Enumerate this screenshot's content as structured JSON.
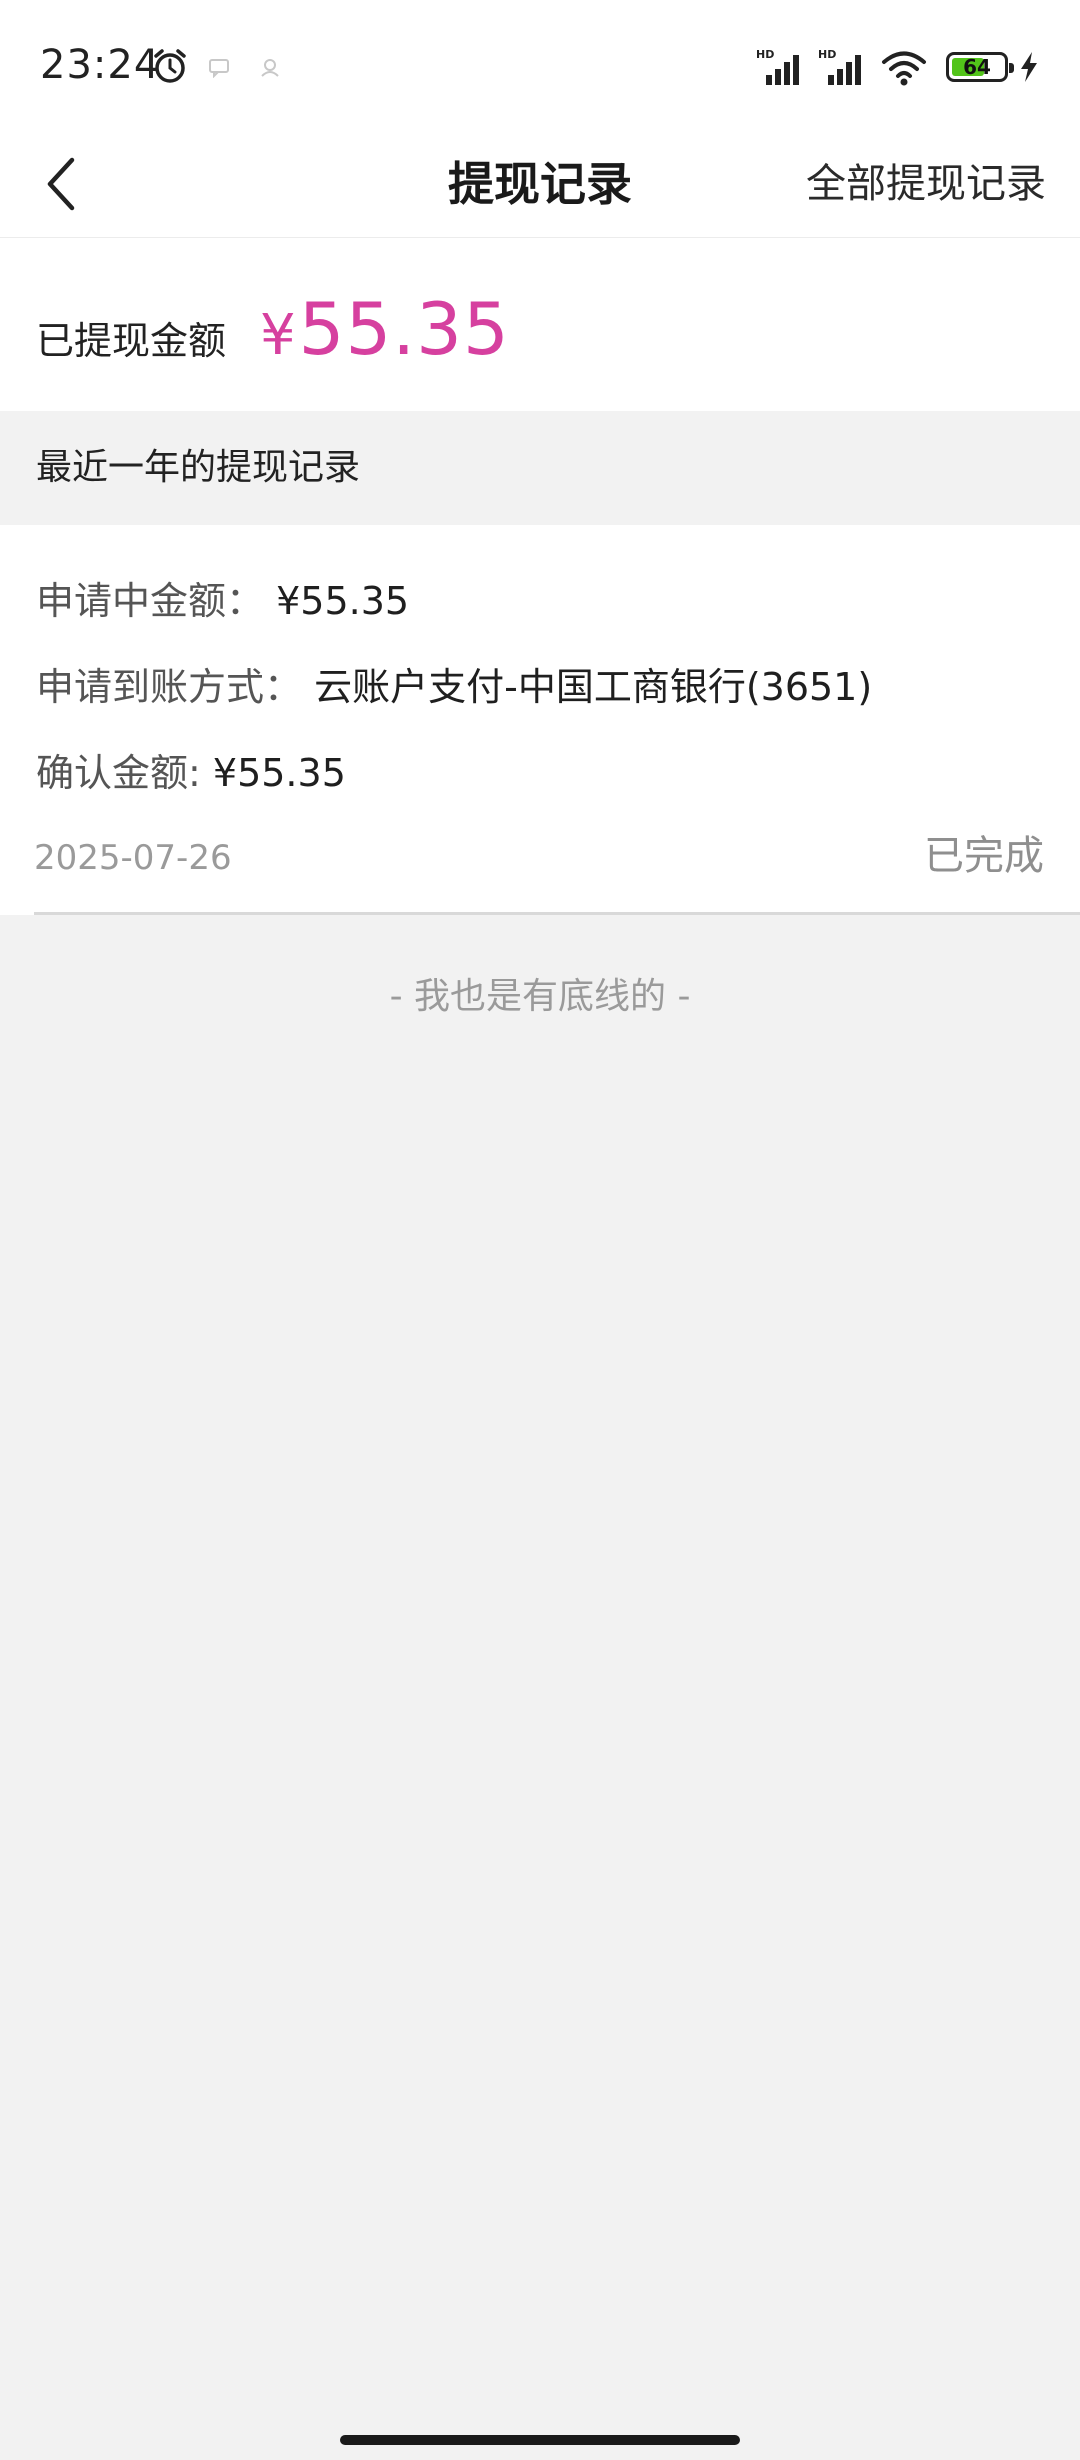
{
  "status_bar": {
    "time": "23:24",
    "battery": "64",
    "battery_level_percent": 64,
    "signal_labels": [
      "HD",
      "HD"
    ],
    "icons": [
      "alarm-icon",
      "message-icon",
      "app-notification-icon",
      "signal-icon",
      "wifi-icon",
      "battery-icon",
      "charging-icon"
    ]
  },
  "nav": {
    "title": "提现记录",
    "right_label": "全部提现记录",
    "back_icon": "chevron-left-icon"
  },
  "summary": {
    "label": "已提现金额",
    "currency": "¥",
    "amount": "55.35"
  },
  "section": {
    "title": "最近一年的提现记录"
  },
  "records": [
    {
      "applying_label": "申请中金额：",
      "applying_value": "¥55.35",
      "method_label": "申请到账方式：",
      "method_value": "云账户支付-中国工商银行(3651)",
      "confirmed_label": "确认金额:",
      "confirmed_value": "¥55.35",
      "date": "2025-07-26",
      "status": "已完成"
    }
  ],
  "footer": {
    "end_text": "- 我也是有底线的 -"
  },
  "colors": {
    "accent": "#d6409f",
    "background": "#f2f2f2",
    "card": "#ffffff",
    "battery": "#52c41a"
  }
}
